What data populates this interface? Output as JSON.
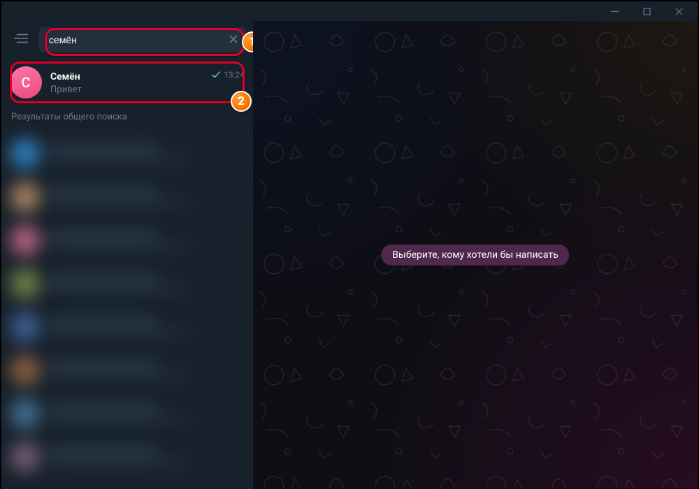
{
  "search": {
    "value": "семён"
  },
  "top_result": {
    "avatar_letter": "C",
    "name": "Семён",
    "time": "13:24",
    "preview": "Привет"
  },
  "section_label": "Результаты общего поиска",
  "main_placeholder": "Выберите, кому хотели бы написать",
  "annotations": {
    "b1": "1",
    "b2": "2"
  },
  "colors": {
    "bg_left": "#17212b",
    "bg_search": "#242f3d",
    "text_muted": "#6a7883",
    "highlight": "#e3002b",
    "avatar_pink": "#e84a7a",
    "check": "#5fb1ef"
  },
  "blur_items": [
    {
      "c": "#2e79b4"
    },
    {
      "c": "#a07e5e"
    },
    {
      "c": "#b05e7e"
    },
    {
      "c": "#6a7c48"
    },
    {
      "c": "#3b5c8f"
    },
    {
      "c": "#845c40"
    },
    {
      "c": "#436b8a"
    },
    {
      "c": "#6d5872"
    }
  ]
}
